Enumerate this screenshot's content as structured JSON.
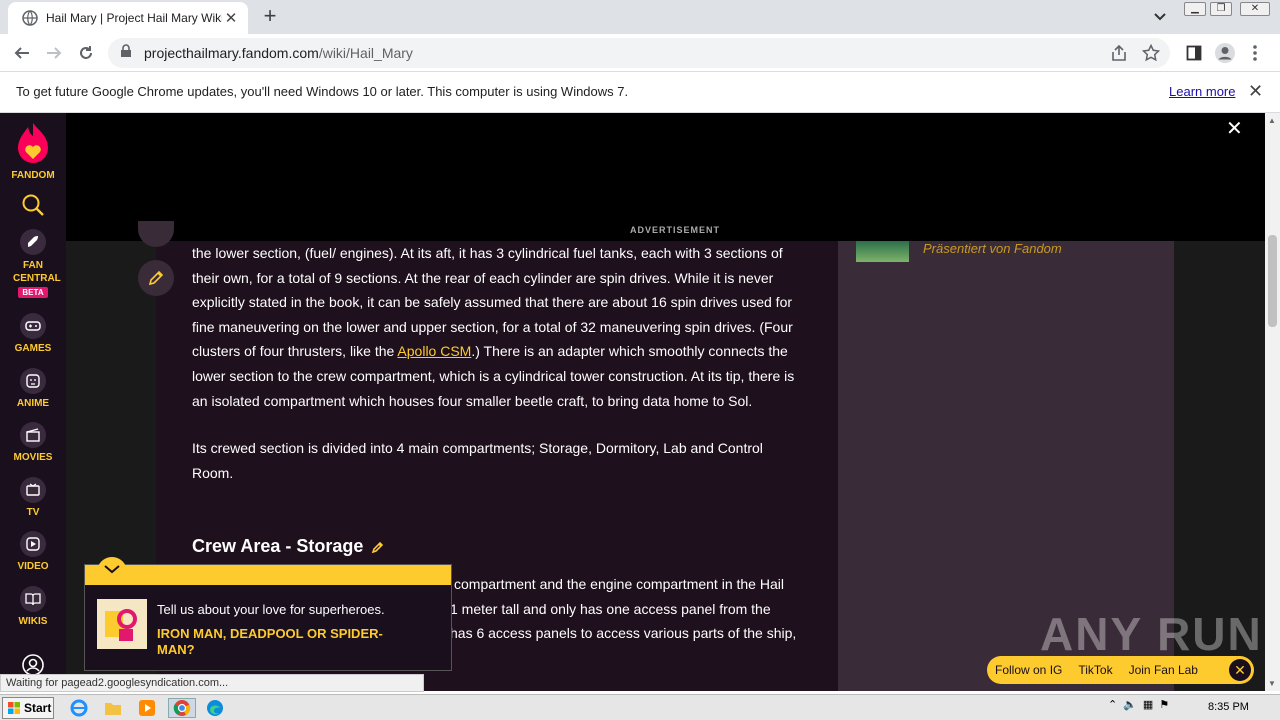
{
  "browser": {
    "tab_title": "Hail Mary | Project Hail Mary Wiki | F",
    "url_domain": "projecthailmary.fandom.com",
    "url_path": "/wiki/Hail_Mary",
    "new_tab": "+",
    "close": "✕"
  },
  "infobar": {
    "message": "To get future Google Chrome updates, you'll need Windows 10 or later. This computer is using Windows 7.",
    "learn_more": "Learn more"
  },
  "sidebar": {
    "logo": "FANDOM",
    "items": [
      {
        "label": "FAN\nCENTRAL",
        "badge": "BETA"
      },
      {
        "label": "GAMES"
      },
      {
        "label": "ANIME"
      },
      {
        "label": "MOVIES"
      },
      {
        "label": "TV"
      },
      {
        "label": "VIDEO"
      },
      {
        "label": "WIKIS"
      }
    ],
    "fan_central": "FAN CENTRAL",
    "beta": "BETA",
    "games": "GAMES",
    "anime": "ANIME",
    "movies": "MOVIES",
    "tv": "TV",
    "video": "VIDEO",
    "wikis": "WIKIS"
  },
  "ad": {
    "label": "ADVERTISEMENT"
  },
  "article": {
    "p1_a": "the lower section, (fuel/ engines). At its aft, it has 3 cylindrical fuel tanks, each with 3 sections of their own, for a total of 9 sections. At the rear of each cylinder are spin drives. While it is never explicitly stated in the book, it can be safely assumed that there are about 16 spin drives used for fine maneuvering on the lower and upper section, for a total of 32 maneuvering spin drives. (Four clusters of four thrusters, like the ",
    "p1_link": "Apollo CSM",
    "p1_b": ".) There is an adapter which smoothly connects the lower section to the crew compartment, which is a cylindrical tower construction. At its tip, there is an isolated compartment which houses four smaller beetle craft, to bring data home to Sol.",
    "p2": "Its crewed section is divided into 4 main compartments; Storage, Dormitory, Lab and Control Room.",
    "heading": "Crew Area - Storage",
    "p3_line1": "compartment and the engine compartment in the Hail",
    "p3_line2": "1 meter tall and only has one access panel from the",
    "p3_line3": "has 6 access panels to access various parts of the ship,"
  },
  "rail": {
    "presented": "Präsentiert von Fandom"
  },
  "popup": {
    "question": "Tell us about your love for superheroes.",
    "answer": "IRON MAN, DEADPOOL OR SPIDER-MAN?"
  },
  "follow": {
    "ig": "Follow on IG",
    "tiktok": "TikTok",
    "fanlab": "Join Fan Lab"
  },
  "watermark": "ANY RUN",
  "status": "Waiting for pagead2.googlesyndication.com...",
  "taskbar": {
    "start": "Start",
    "time": "8:35 PM"
  },
  "colors": {
    "fandom_yellow": "#fecb2f",
    "fandom_pink": "#fa005a",
    "content_bg": "#1e101c"
  }
}
